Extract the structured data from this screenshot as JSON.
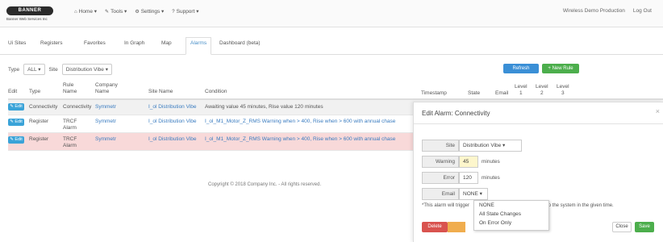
{
  "logo": {
    "badge": "BANNER",
    "subtitle": "Banner Web Services Inc"
  },
  "topnav": [
    {
      "icon": "home-icon",
      "glyph": "⌂",
      "label": "Home ▾"
    },
    {
      "icon": "wrench-icon",
      "glyph": "✎",
      "label": "Tools ▾"
    },
    {
      "icon": "gear-icon",
      "glyph": "⚙",
      "label": "Settings ▾"
    },
    {
      "icon": "help-icon",
      "glyph": "?",
      "label": "Support ▾"
    }
  ],
  "user": {
    "name": "Wireless Demo Production",
    "logout": "Log Out"
  },
  "tabs": [
    {
      "label": "Ui Sites",
      "active": false
    },
    {
      "label": "Registers",
      "active": false
    },
    {
      "label": "Favorites",
      "active": false
    },
    {
      "label": "In Graph",
      "active": false
    },
    {
      "label": "Map",
      "active": false
    },
    {
      "label": "Alarms",
      "active": true
    },
    {
      "label": "Dashboard (beta)",
      "active": false
    }
  ],
  "filters": {
    "type_label": "Type",
    "type_value": "ALL ▾",
    "site_label": "Site",
    "site_value": "Distribution Vibe ▾"
  },
  "buttons": {
    "refresh": "Refresh",
    "new_rule": "+ New Rule"
  },
  "columns": {
    "edit": "Edit",
    "type": "Type",
    "rule_name": [
      "Rule",
      "Name"
    ],
    "company_name": [
      "Company",
      "Name"
    ],
    "site_name": "Site Name",
    "condition": "Condition",
    "timestamp": "Timestamp",
    "state": "State",
    "email": "Email",
    "level1": [
      "Level",
      "1"
    ],
    "level2": [
      "Level",
      "2"
    ],
    "level3": [
      "Level",
      "3"
    ]
  },
  "rows": [
    {
      "edit": "✎ Edit",
      "type": "Connectivity",
      "rule": "Connectivity",
      "company": "Symmetr",
      "site": "I_ol Distribution Vibe",
      "condition": "Awaiting value 45 minutes, Rise value 120 minutes"
    },
    {
      "edit": "✎ Edit",
      "type": "Register",
      "rule": "TRCF Alarm",
      "company": "Symmetr",
      "site": "I_ol Distribution Vibe",
      "condition": "I_ol_M1_Motor_Z_RMS Warning when > 400, Rise when > 600 with annual chase"
    },
    {
      "edit": "✎ Edit",
      "type": "Register",
      "rule": "TRCF Alarm",
      "company": "Symmetr",
      "site": "I_ol Distribution Vibe",
      "condition": "I_ol_M1_Motor_Z_RMS Warning when > 400, Rise when > 600 with annual chase"
    }
  ],
  "copyright": "Copyright © 2018 Company Inc. - All rights reserved.",
  "panel": {
    "title": "Edit Alarm: Connectivity",
    "fields": [
      {
        "label": "Site",
        "value": "Distribution Vibe ▾",
        "unit": ""
      },
      {
        "label": "Warning",
        "value": "45",
        "unit": "minutes"
      },
      {
        "label": "Error",
        "value": "120",
        "unit": "minutes"
      },
      {
        "label": "Email",
        "value": "NONE ▾",
        "unit": ""
      }
    ],
    "menu": [
      "NONE",
      "All State Changes",
      "On Error Only"
    ],
    "note": "*This alarm will trigger",
    "note_tail": "to the system in the given time.",
    "delete": "Delete Alarm",
    "orange": "",
    "close": "Close",
    "save": "Save"
  },
  "colors": {
    "primary": "#3a8fd6",
    "success": "#4cae4c",
    "danger": "#d9534f",
    "row_error": "#f8d9d9"
  }
}
